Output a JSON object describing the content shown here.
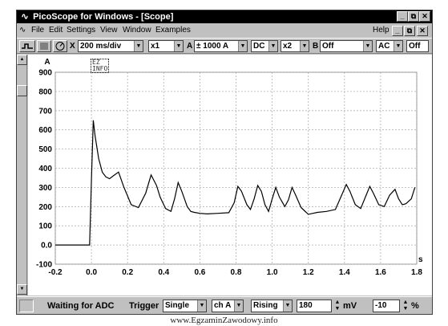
{
  "window": {
    "title": "PicoScope for Windows - [Scope]",
    "controls": [
      "_",
      "⧉",
      "✕"
    ]
  },
  "menubar": {
    "items": [
      "File",
      "Edit",
      "Settings",
      "View",
      "Window",
      "Examples"
    ],
    "help": "Help",
    "controls": [
      "_",
      "⧉",
      "✕"
    ]
  },
  "toolbar": {
    "x_label": "X",
    "timebase": "200 ms/div",
    "x_mult": "x1",
    "a_label": "A",
    "a_range": "± 1000 A",
    "a_coupling": "DC",
    "a_mult": "x2",
    "b_label": "B",
    "b_range": "Off",
    "b_coupling": "AC",
    "b_extra": "Off"
  },
  "plot": {
    "info_line1": "EZ",
    "info_line2": "INFO"
  },
  "chart_data": {
    "type": "line",
    "title": "",
    "xlabel": "s",
    "ylabel": "A",
    "xlim": [
      -0.2,
      1.8
    ],
    "ylim": [
      -100,
      900
    ],
    "xticks": [
      -0.2,
      0.0,
      0.2,
      0.4,
      0.6,
      0.8,
      1.0,
      1.2,
      1.4,
      1.6,
      1.8
    ],
    "xtick_labels": [
      "-0.2",
      "0.0",
      "0.2",
      "0.4",
      "0.6",
      "0.8",
      "1.0",
      "1.2",
      "1.4",
      "1.6",
      "1.8"
    ],
    "yticks": [
      -100,
      0,
      100,
      200,
      300,
      400,
      500,
      600,
      700,
      800,
      900
    ],
    "ytick_labels": [
      "-100",
      "0.0",
      "100",
      "200",
      "300",
      "400",
      "500",
      "600",
      "700",
      "800",
      "900"
    ],
    "grid": true,
    "series": [
      {
        "color": "#000000",
        "x": [
          -0.2,
          -0.01,
          0.0,
          0.01,
          0.02,
          0.04,
          0.06,
          0.08,
          0.1,
          0.12,
          0.15,
          0.18,
          0.22,
          0.26,
          0.3,
          0.33,
          0.36,
          0.38,
          0.41,
          0.44,
          0.46,
          0.48,
          0.5,
          0.53,
          0.55,
          0.57,
          0.6,
          0.64,
          0.7,
          0.76,
          0.79,
          0.81,
          0.83,
          0.86,
          0.88,
          0.9,
          0.92,
          0.94,
          0.96,
          0.98,
          1.0,
          1.02,
          1.04,
          1.07,
          1.09,
          1.11,
          1.13,
          1.16,
          1.2,
          1.25,
          1.3,
          1.35,
          1.38,
          1.41,
          1.43,
          1.46,
          1.49,
          1.52,
          1.54,
          1.56,
          1.59,
          1.62,
          1.65,
          1.68,
          1.7,
          1.72,
          1.74,
          1.77,
          1.79
        ],
        "y": [
          0,
          0,
          340,
          650,
          570,
          450,
          380,
          355,
          345,
          360,
          380,
          300,
          210,
          195,
          270,
          365,
          310,
          250,
          190,
          175,
          240,
          325,
          280,
          200,
          175,
          170,
          165,
          162,
          165,
          168,
          220,
          305,
          280,
          210,
          185,
          240,
          310,
          280,
          210,
          175,
          240,
          300,
          250,
          200,
          235,
          300,
          260,
          195,
          160,
          170,
          175,
          185,
          250,
          315,
          280,
          210,
          190,
          260,
          305,
          270,
          210,
          200,
          260,
          290,
          240,
          210,
          215,
          240,
          300
        ]
      }
    ]
  },
  "status": {
    "text": "Waiting for ADC",
    "trigger_label": "Trigger",
    "trigger_mode": "Single",
    "trigger_channel": "ch A",
    "trigger_edge": "Rising",
    "trigger_level": "180",
    "level_unit": "mV",
    "delay": "-10",
    "delay_unit": "%"
  },
  "watermark": "www.EgzaminZawodowy.info"
}
